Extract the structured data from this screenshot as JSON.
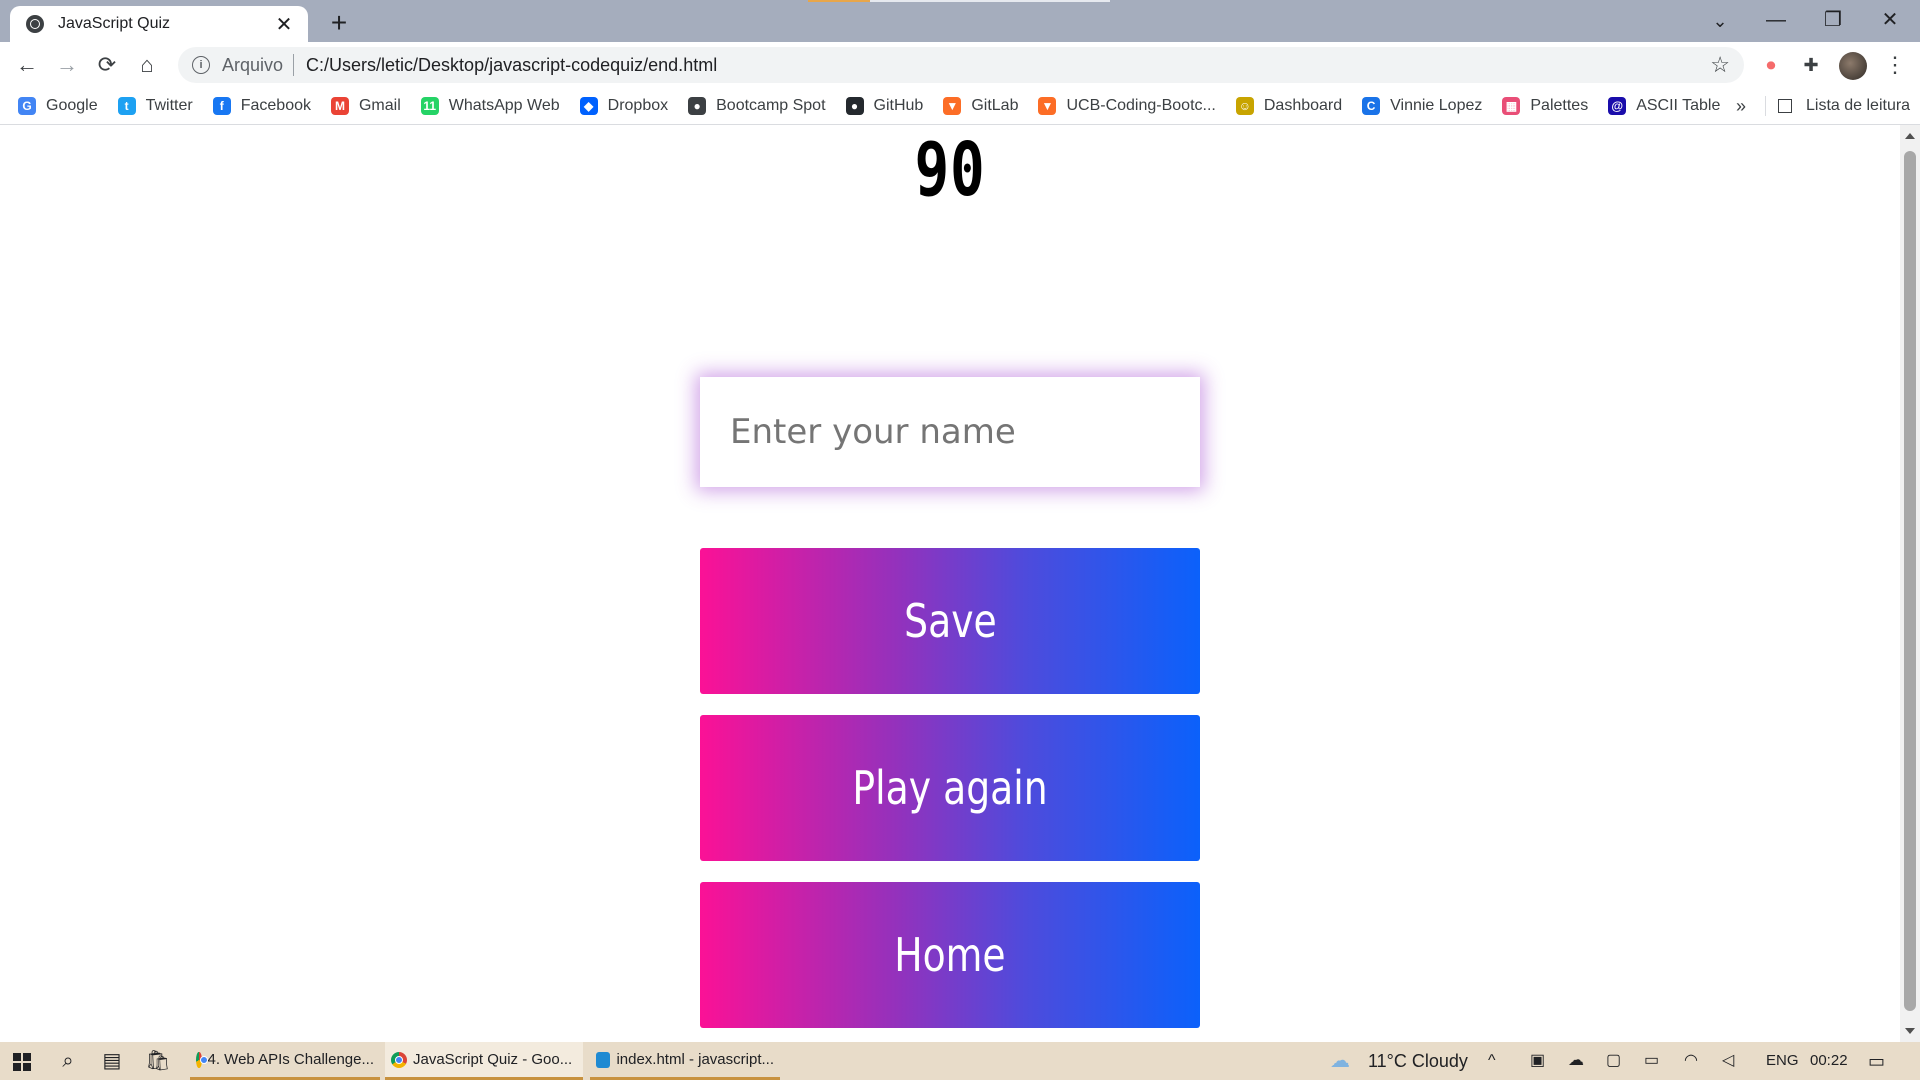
{
  "browser": {
    "tab": {
      "title": "JavaScript Quiz",
      "close": "✕"
    },
    "new_tab": "+",
    "tab_search": "⌄",
    "window": {
      "minimize": "—",
      "maximize": "❐",
      "close": "✕"
    },
    "nav": {
      "back": "←",
      "forward": "→",
      "reload": "⟳",
      "home": "⌂"
    },
    "address": {
      "scheme_label": "Arquivo",
      "url": "C:/Users/letic/Desktop/javascript-codequiz/end.html",
      "star": "☆",
      "info": "i"
    },
    "extensions": {
      "record": "⏺",
      "puzzle": "✚",
      "menu": "⋮"
    },
    "bookmarks": [
      {
        "label": "Google",
        "icon": "google-icon",
        "color": "#4285f4",
        "glyph": "G"
      },
      {
        "label": "Twitter",
        "icon": "twitter-icon",
        "color": "#1da1f2",
        "glyph": "t"
      },
      {
        "label": "Facebook",
        "icon": "facebook-icon",
        "color": "#1877f2",
        "glyph": "f"
      },
      {
        "label": "Gmail",
        "icon": "gmail-icon",
        "color": "#ea4335",
        "glyph": "M"
      },
      {
        "label": "WhatsApp Web",
        "icon": "whatsapp-icon",
        "color": "#25d366",
        "glyph": "11"
      },
      {
        "label": "Dropbox",
        "icon": "dropbox-icon",
        "color": "#0061fe",
        "glyph": "◆"
      },
      {
        "label": "Bootcamp Spot",
        "icon": "globe-icon",
        "color": "#3c4043",
        "glyph": "●"
      },
      {
        "label": "GitHub",
        "icon": "github-icon",
        "color": "#24292e",
        "glyph": "●"
      },
      {
        "label": "GitLab",
        "icon": "gitlab-icon",
        "color": "#fc6d26",
        "glyph": "▼"
      },
      {
        "label": "UCB-Coding-Bootc...",
        "icon": "gitlab-icon",
        "color": "#fc6d26",
        "glyph": "▼"
      },
      {
        "label": "Dashboard",
        "icon": "dashboard-icon",
        "color": "#c8a400",
        "glyph": "☺"
      },
      {
        "label": "Vinnie Lopez",
        "icon": "vinnie-icon",
        "color": "#1a73e8",
        "glyph": "C"
      },
      {
        "label": "Palettes",
        "icon": "palette-icon",
        "color": "#e94e77",
        "glyph": "▦"
      },
      {
        "label": "ASCII Table",
        "icon": "ascii-icon",
        "color": "#1a0dab",
        "glyph": "@"
      }
    ],
    "bookmarks_more": "»",
    "reading_list": "Lista de leitura"
  },
  "page": {
    "score": "90",
    "name_input": {
      "placeholder": "Enter your name",
      "value": ""
    },
    "buttons": {
      "save": "Save",
      "play_again": "Play again",
      "home": "Home"
    },
    "colors": {
      "gradient_start": "#fb1196",
      "gradient_end": "#0b61fb",
      "input_glow": "#9933cc"
    }
  },
  "taskbar": {
    "search": "⌕",
    "taskview": "▤",
    "store": "🛍",
    "apps": [
      {
        "label": "4. Web APIs Challenge...",
        "icon": "chrome-icon"
      },
      {
        "label": "JavaScript Quiz - Goo...",
        "icon": "chrome-icon"
      },
      {
        "label": "index.html - javascript...",
        "icon": "vscode-icon"
      }
    ],
    "weather": {
      "temperature": "11°C",
      "condition": "Cloudy",
      "icon": "cloud-icon"
    },
    "tray_chevron": "^",
    "language": "ENG",
    "clock": "00:22",
    "notifications": "▭"
  }
}
